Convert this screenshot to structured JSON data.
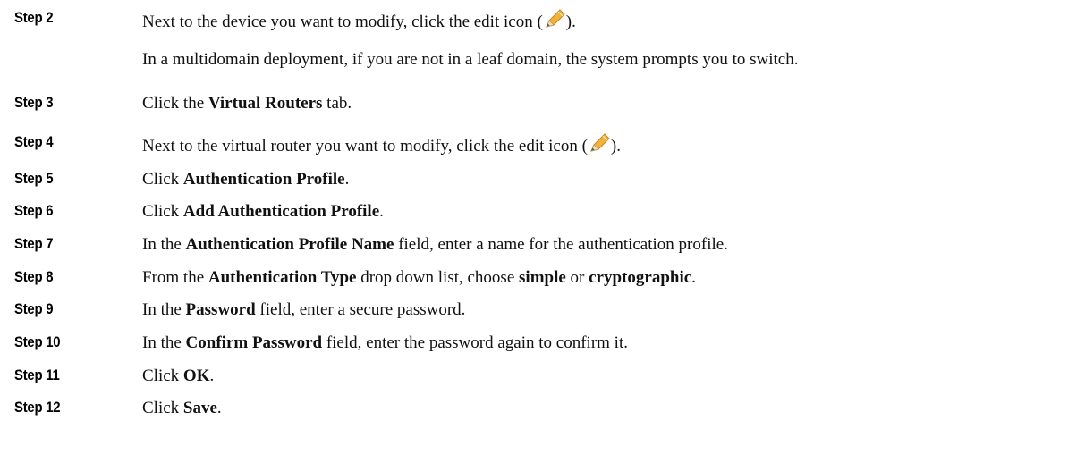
{
  "steps": [
    {
      "label": "Step 2",
      "parts": [
        "Next to the device you want to modify, click the edit icon (",
        ")."
      ],
      "icon": "pencil-edit-icon",
      "note": "In a multidomain deployment, if you are not in a leaf domain, the system prompts you to switch."
    },
    {
      "label": "Step 3",
      "pre": "Click the ",
      "bold": "Virtual Routers",
      "post": " tab."
    },
    {
      "label": "Step 4",
      "parts": [
        "Next to the virtual router you want to modify, click the edit icon (",
        ")."
      ],
      "icon": "pencil-edit-icon"
    },
    {
      "label": "Step 5",
      "pre": "Click ",
      "bold": "Authentication Profile",
      "post": "."
    },
    {
      "label": "Step 6",
      "pre": "Click ",
      "bold": "Add Authentication Profile",
      "post": "."
    },
    {
      "label": "Step 7",
      "pre": "In the ",
      "bold": "Authentication Profile Name",
      "post": " field, enter a name for the authentication profile."
    },
    {
      "label": "Step 8",
      "pre": "From the ",
      "bold": "Authentication Type",
      "mid1": " drop down list, choose ",
      "bold2": "simple",
      "mid2": " or ",
      "bold3": "cryptographic",
      "post": "."
    },
    {
      "label": "Step 9",
      "pre": "In the ",
      "bold": "Password",
      "post": " field, enter a secure password."
    },
    {
      "label": "Step 10",
      "pre": "In the ",
      "bold": "Confirm Password",
      "post": " field, enter the password again to confirm it."
    },
    {
      "label": "Step 11",
      "pre": "Click ",
      "bold": "OK",
      "post": "."
    },
    {
      "label": "Step 12",
      "pre": "Click ",
      "bold": "Save",
      "post": "."
    }
  ],
  "colors": {
    "text": "#111111",
    "label": "#000000",
    "pencil_body": "#f0b23a",
    "pencil_tip": "#e8d4a6"
  }
}
